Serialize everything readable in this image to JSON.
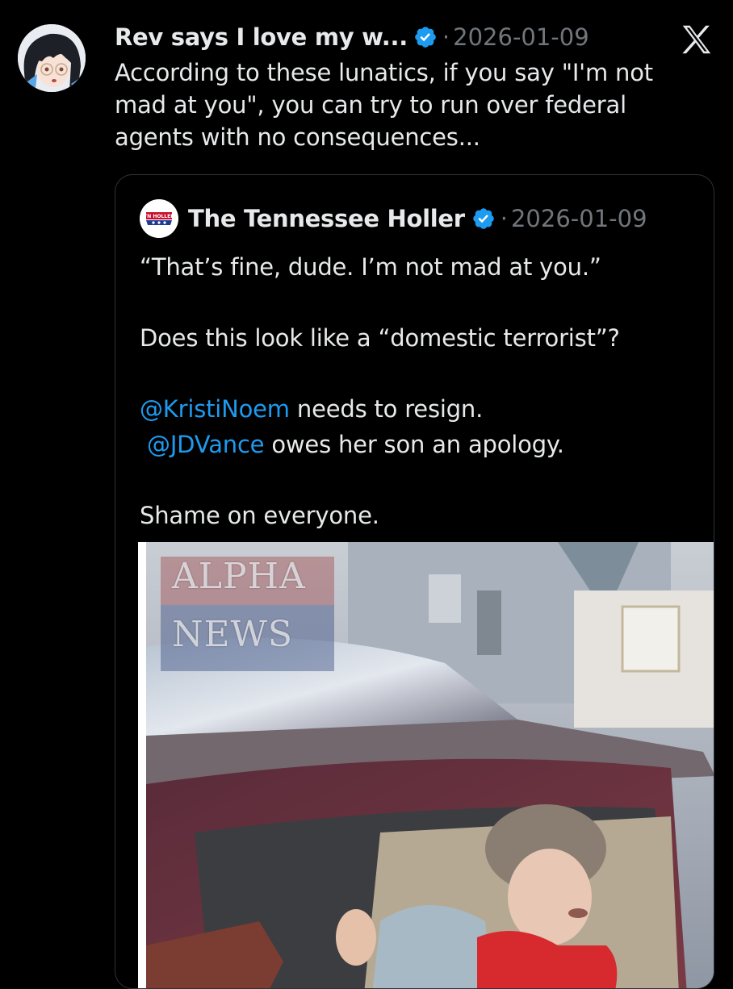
{
  "tweet": {
    "author_name": "Rev says I love my w...",
    "date": "2026-01-09",
    "separator": "·",
    "text": "According to these lunatics, if you say \"I'm not mad at you\", you can try to run over federal agents with no consequences..."
  },
  "quote": {
    "author_name": "The Tennessee Holler",
    "avatar_text": "TN HOLLER",
    "date": "2026-01-09",
    "separator": "·",
    "paragraphs": {
      "p1": "“That’s fine, dude. I’m not mad at you.”",
      "p2": "Does this look like a “domestic terrorist”?",
      "mention1": "@KristiNoem",
      "after_mention1": " needs to resign.",
      "mention2": "@JDVance",
      "after_mention2": " owes her son an apology.",
      "p4": "Shame on everyone."
    },
    "media": {
      "watermark_line1": "ALPHA",
      "watermark_line2": "NEWS"
    }
  },
  "colors": {
    "background": "#000000",
    "text": "#e7e9ea",
    "muted": "#71767b",
    "mention": "#1d9bf0",
    "verified": "#1d9bf0",
    "border": "#2f3336"
  },
  "icons": {
    "verified": "verified-badge-icon",
    "platform": "x-logo-icon"
  }
}
